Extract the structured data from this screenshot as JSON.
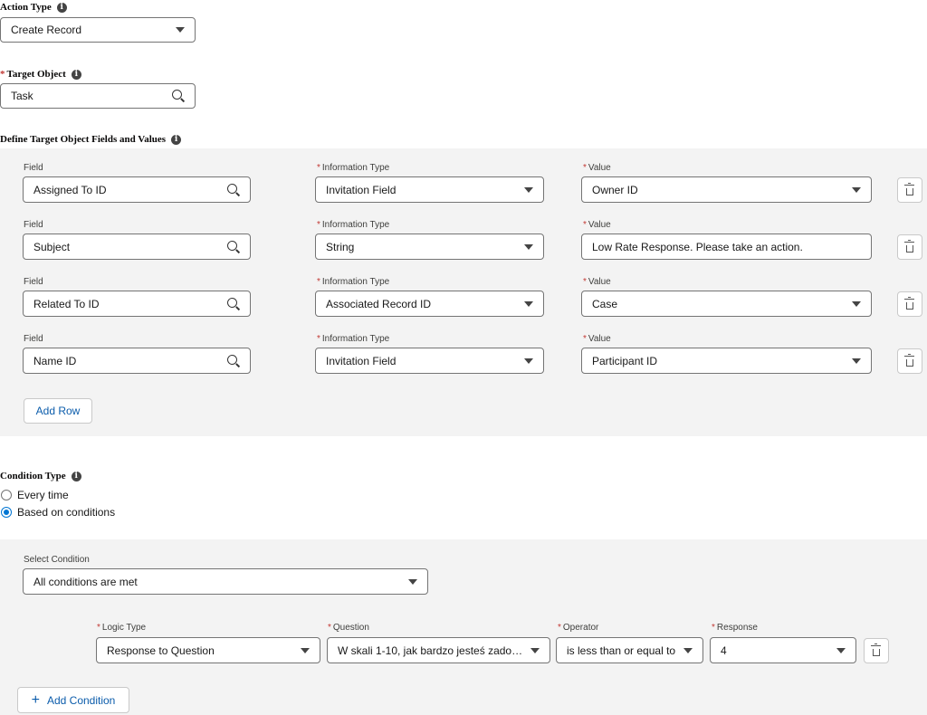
{
  "action_type": {
    "label": "Action Type",
    "value": "Create Record"
  },
  "target_object": {
    "label": "Target Object",
    "value": "Task"
  },
  "fields_section": {
    "label": "Define Target Object Fields and Values",
    "field_label": "Field",
    "info_type_label": "Information Type",
    "value_label": "Value",
    "rows": [
      {
        "field": "Assigned To ID",
        "info_type": "Invitation Field",
        "value": "Owner ID"
      },
      {
        "field": "Subject",
        "info_type": "String",
        "value": "Low Rate Response. Please take an action."
      },
      {
        "field": "Related To ID",
        "info_type": "Associated Record ID",
        "value": "Case"
      },
      {
        "field": "Name ID",
        "info_type": "Invitation Field",
        "value": "Participant ID"
      }
    ],
    "add_row_label": "Add Row"
  },
  "condition_type": {
    "label": "Condition Type",
    "options": [
      "Every time",
      "Based on conditions"
    ],
    "selected": "Based on conditions"
  },
  "conditions": {
    "select_label": "Select Condition",
    "select_value": "All conditions are met",
    "logic_type_label": "Logic Type",
    "question_label": "Question",
    "operator_label": "Operator",
    "response_label": "Response",
    "row": {
      "logic_type": "Response to Question",
      "question": "W skali 1-10, jak bardzo jesteś zadow...",
      "operator": "is less than or equal to",
      "response": "4"
    },
    "add_condition_label": "Add Condition"
  },
  "icons": [
    "info-icon",
    "search-icon",
    "chevron-down-icon",
    "trash-icon",
    "plus-icon"
  ],
  "colors": {
    "accent": "#0176d3",
    "link": "#0b5cab",
    "required": "#c23934",
    "panel": "#f3f3f3"
  }
}
